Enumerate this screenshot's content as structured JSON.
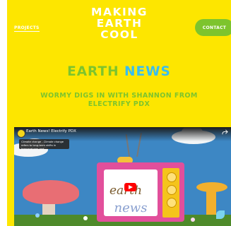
{
  "header": {
    "nav_link": "PROJECTS",
    "logo_lines": [
      "MAKING",
      "EARTH",
      "COOL"
    ],
    "contact_button": "CONTACT"
  },
  "hero": {
    "headline_part1": "EARTH",
    "headline_part2": "NEWS",
    "subhead": "WORMY DIGS IN WITH SHANNON FROM ELECTRIFY PDX"
  },
  "video": {
    "title": "Earth News! Electrify PDX",
    "tooltip": "Climate change - Climate change refers to long-term shifts in temperatures and...",
    "screen_word_1": "earth",
    "screen_word_2": "news"
  },
  "colors": {
    "page_background": "#fde600",
    "accent_green": "#7dc42d",
    "accent_blue": "#38bdf0"
  }
}
